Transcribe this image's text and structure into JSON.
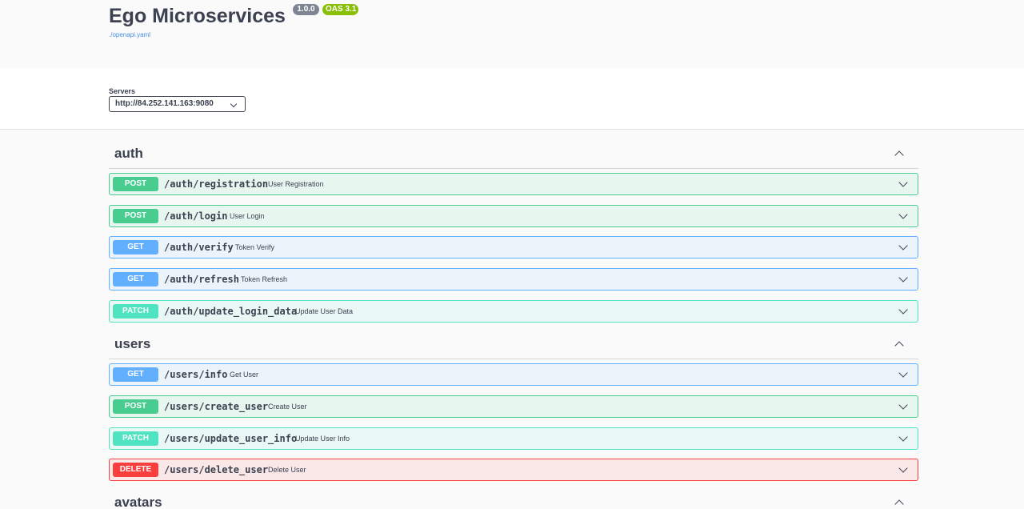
{
  "info": {
    "title": "Ego Microservices",
    "version": "1.0.0",
    "oas": "OAS 3.1",
    "spec_link": "./openapi.yaml"
  },
  "servers": {
    "label": "Servers",
    "selected": "http://84.252.141.163:9080"
  },
  "tags": [
    {
      "name": "auth",
      "operations": [
        {
          "method": "POST",
          "path": "/auth/registration",
          "summary": "User Registration"
        },
        {
          "method": "POST",
          "path": "/auth/login",
          "summary": "User Login"
        },
        {
          "method": "GET",
          "path": "/auth/verify",
          "summary": "Token Verify"
        },
        {
          "method": "GET",
          "path": "/auth/refresh",
          "summary": "Token Refresh"
        },
        {
          "method": "PATCH",
          "path": "/auth/update_login_data",
          "summary": "Update User Data"
        }
      ]
    },
    {
      "name": "users",
      "operations": [
        {
          "method": "GET",
          "path": "/users/info",
          "summary": "Get User"
        },
        {
          "method": "POST",
          "path": "/users/create_user",
          "summary": "Create User"
        },
        {
          "method": "PATCH",
          "path": "/users/update_user_info",
          "summary": "Update User Info"
        },
        {
          "method": "DELETE",
          "path": "/users/delete_user",
          "summary": "Delete User"
        }
      ]
    },
    {
      "name": "avatars",
      "operations": []
    }
  ],
  "colors": {
    "post": "#49cc90",
    "get": "#61affe",
    "patch": "#50e3c2",
    "delete": "#f93e3e"
  }
}
